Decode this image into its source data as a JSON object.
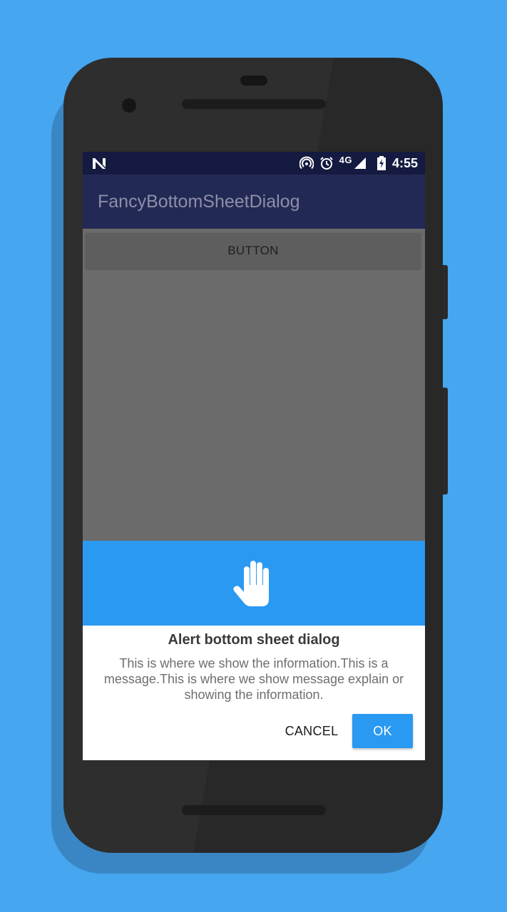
{
  "status_bar": {
    "carrier_icon": "n-logo-icon",
    "icons": [
      "hotspot-icon",
      "alarm-icon",
      "signal-icon",
      "battery-charging-icon"
    ],
    "network_label": "4G",
    "time": "4:55"
  },
  "app_bar": {
    "title": "FancyBottomSheetDialog"
  },
  "content": {
    "button_label": "BUTTON"
  },
  "dialog": {
    "icon": "hand-stop-icon",
    "title": "Alert bottom sheet dialog",
    "message": "This is where we show the information.This is a message.This is where we show message explain or showing the information.",
    "cancel_label": "CANCEL",
    "ok_label": "OK"
  },
  "colors": {
    "background": "#46A6EF",
    "status_bar": "#141A40",
    "app_bar": "#232955",
    "dialog_accent": "#2A99F2",
    "scrim_content": "#6B6B6B"
  }
}
